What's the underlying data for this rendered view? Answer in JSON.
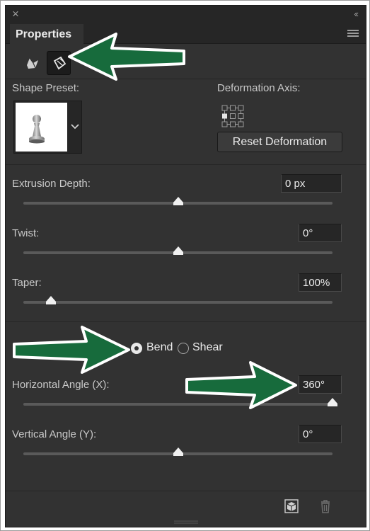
{
  "panel": {
    "tab_title": "Properties",
    "mode_icons": [
      "scene-icon",
      "deformation-icon"
    ],
    "active_mode": "deformation-icon"
  },
  "shape_preset": {
    "label": "Shape Preset:",
    "selected_icon": "pawn-icon"
  },
  "deformation_axis": {
    "label": "Deformation Axis:",
    "reset_label": "Reset Deformation"
  },
  "extrusion_depth": {
    "label": "Extrusion Depth:",
    "value": "0 px",
    "slider_fraction": 0.5
  },
  "twist": {
    "label": "Twist:",
    "value": "0°",
    "slider_fraction": 0.5
  },
  "taper": {
    "label": "Taper:",
    "value": "100%",
    "slider_fraction": 0.09
  },
  "mode": {
    "bend_label": "Bend",
    "shear_label": "Shear",
    "selected": "Bend"
  },
  "horizontal_angle": {
    "label": "Horizontal Angle (X):",
    "value": "360°",
    "slider_fraction": 1.0
  },
  "vertical_angle": {
    "label": "Vertical Angle (Y):",
    "value": "0°",
    "slider_fraction": 0.5
  },
  "footer": {
    "icons": [
      "new-3d-object-icon",
      "trash-icon"
    ]
  },
  "colors": {
    "panel_bg": "#323232",
    "annotation_arrow": "#176b3c"
  }
}
